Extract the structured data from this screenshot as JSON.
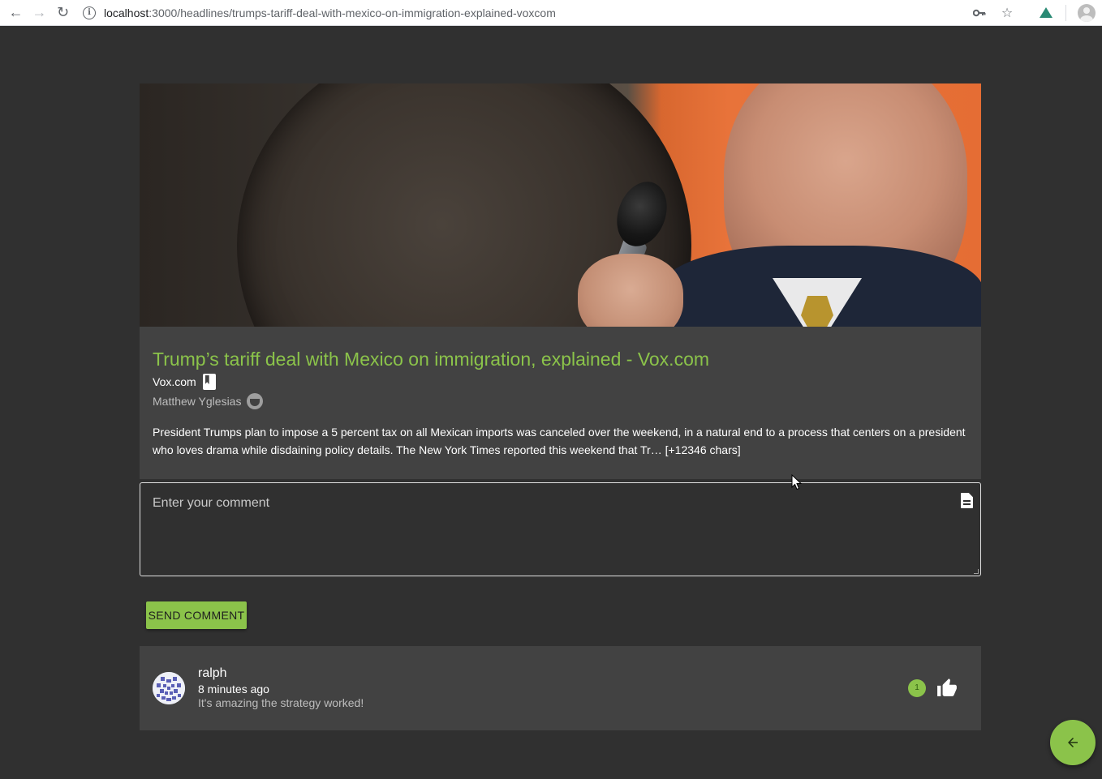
{
  "browser": {
    "url_host": "localhost",
    "url_path": ":3000/headlines/trumps-tariff-deal-with-mexico-on-immigration-explained-voxcom"
  },
  "article": {
    "title": "Trump’s tariff deal with Mexico on immigration, explained - Vox.com",
    "source": "Vox.com",
    "author": "Matthew Yglesias",
    "summary": "President Trumps plan to impose a 5 percent tax on all Mexican imports was canceled over the weekend, in a natural end to a process that centers on a president who loves drama while disdaining policy details. The New York Times reported this weekend that Tr… [+12346 chars]"
  },
  "comment_form": {
    "placeholder": "Enter your comment",
    "send_label": "SEND COMMENT"
  },
  "comments": [
    {
      "user": "ralph",
      "time": "8 minutes ago",
      "text": "It's amazing the strategy worked!",
      "likes": "1"
    }
  ],
  "colors": {
    "accent": "#8bc34a",
    "background": "#303030",
    "card": "#424242"
  },
  "icons": [
    "back-arrow-icon",
    "forward-arrow-icon",
    "reload-icon",
    "info-icon",
    "key-icon",
    "star-icon",
    "vue-devtools-icon",
    "profile-icon",
    "bookmark-icon",
    "face-icon",
    "document-icon",
    "thumb-up-icon",
    "arrow-left-icon"
  ]
}
